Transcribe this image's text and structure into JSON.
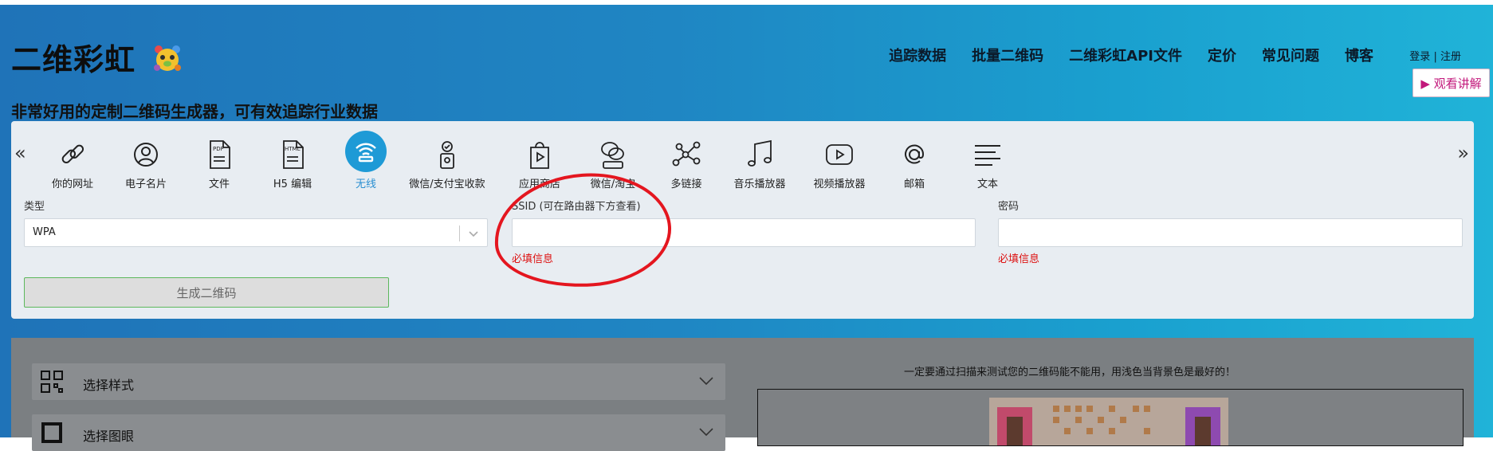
{
  "brand": {
    "name": "二维彩虹",
    "logo_icon": "rainbow-bear-icon"
  },
  "tagline": "非常好用的定制二维码生成器，可有效追踪行业数据",
  "nav": [
    {
      "label": "追踪数据"
    },
    {
      "label": "批量二维码"
    },
    {
      "label": "二维彩虹API文件"
    },
    {
      "label": "定价"
    },
    {
      "label": "常见问题"
    },
    {
      "label": "博客"
    }
  ],
  "auth": {
    "login": "登录",
    "sep": "|",
    "register": "注册"
  },
  "watch_button": {
    "label": "▶ 观看讲解"
  },
  "types": [
    {
      "label": "你的网址",
      "icon": "link-icon"
    },
    {
      "label": "电子名片",
      "icon": "user-icon"
    },
    {
      "label": "文件",
      "icon": "pdf-icon"
    },
    {
      "label": "H5 编辑",
      "icon": "html-icon"
    },
    {
      "label": "无线",
      "icon": "wifi-icon",
      "active": true
    },
    {
      "label": "微信/支付宝收款",
      "icon": "payment-icon"
    },
    {
      "label": "应用商店",
      "icon": "app-store-icon"
    },
    {
      "label": "微信/淘宝",
      "icon": "wechat-icon"
    },
    {
      "label": "多链接",
      "icon": "multi-link-icon"
    },
    {
      "label": "音乐播放器",
      "icon": "music-icon"
    },
    {
      "label": "视频播放器",
      "icon": "video-icon"
    },
    {
      "label": "邮箱",
      "icon": "email-icon"
    },
    {
      "label": "文本",
      "icon": "text-icon"
    }
  ],
  "form": {
    "type_label": "类型",
    "type_value": "WPA",
    "ssid_label": "SSID (可在路由器下方查看)",
    "ssid_value": "",
    "ssid_error": "必填信息",
    "password_label": "密码",
    "password_value": "",
    "password_error": "必填信息",
    "generate_label": "生成二维码"
  },
  "lower": {
    "accordion": [
      {
        "label": "选择样式",
        "icon": "qr-style-icon"
      },
      {
        "label": "选择图眼",
        "icon": "qr-eye-icon"
      }
    ],
    "note": "一定要通过扫描来测试您的二维码能不能用，用浅色当背景色是最好的！"
  },
  "colors": {
    "accent": "#1e9ad6",
    "error": "#dd1111",
    "annotation": "#e4161f",
    "watch": "#c2187b"
  }
}
